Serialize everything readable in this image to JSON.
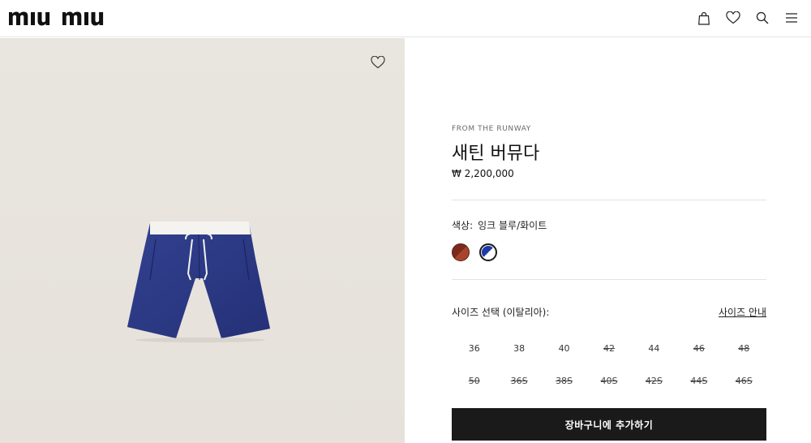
{
  "header": {
    "logo_text": "miu miu",
    "icons": [
      "bag-icon",
      "heart-icon",
      "search-icon",
      "menu-icon"
    ]
  },
  "gallery": {
    "wishlist_icon": "heart-icon",
    "product_image": "navy-shorts-white-waistband"
  },
  "product": {
    "eyebrow": "FROM THE RUNWAY",
    "title": "새틴 버뮤다",
    "price": "₩ 2,200,000"
  },
  "color": {
    "label": "색상:",
    "value": "잉크 블루/화이트",
    "swatches": [
      {
        "name": "brick-red",
        "color": "#8a3420",
        "selected": false
      },
      {
        "name": "ink-blue-white",
        "color": "#1d3aa8",
        "selected": true
      }
    ]
  },
  "size": {
    "label": "사이즈 선택 (이탈리아):",
    "guide_label": "사이즈 안내",
    "options": [
      {
        "label": "36",
        "available": true
      },
      {
        "label": "38",
        "available": true
      },
      {
        "label": "40",
        "available": true
      },
      {
        "label": "42",
        "available": false
      },
      {
        "label": "44",
        "available": true
      },
      {
        "label": "46",
        "available": false
      },
      {
        "label": "48",
        "available": false
      },
      {
        "label": "50",
        "available": false
      },
      {
        "label": "36S",
        "available": false
      },
      {
        "label": "38S",
        "available": false
      },
      {
        "label": "40S",
        "available": false
      },
      {
        "label": "42S",
        "available": false
      },
      {
        "label": "44S",
        "available": false
      },
      {
        "label": "46S",
        "available": false
      }
    ]
  },
  "cta": {
    "label": "장바구니에 추가하기"
  }
}
